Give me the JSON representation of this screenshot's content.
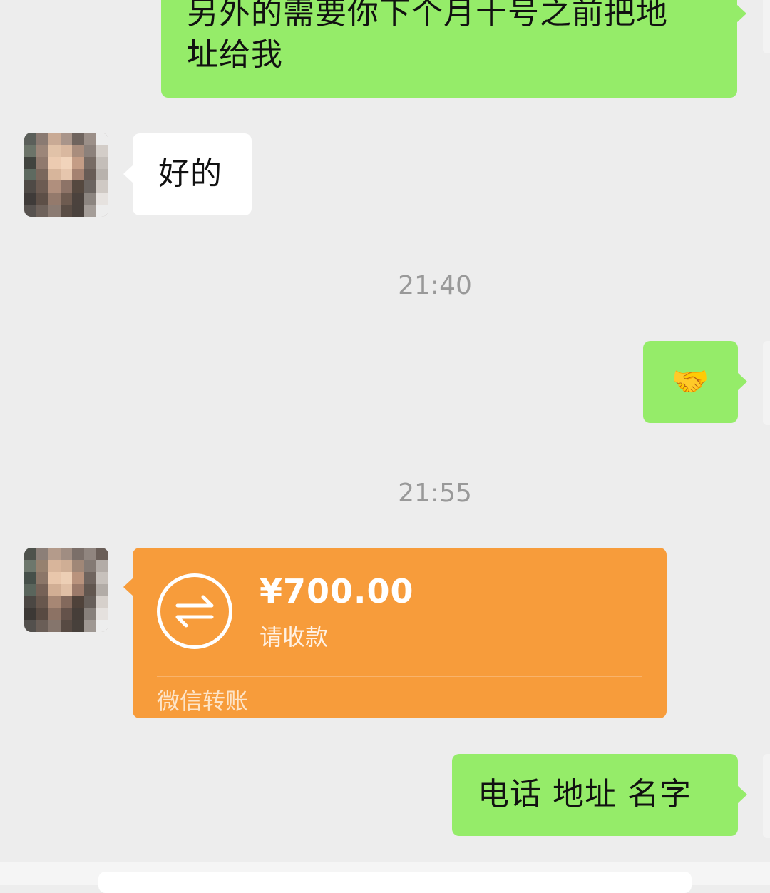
{
  "messages": {
    "m1_line1": "另外的需要你下个月十号之前把地",
    "m1_line2": "址给我",
    "m2": "好的",
    "time1": "21:40",
    "m3_emoji": "🤝",
    "time2": "21:55",
    "transfer": {
      "amount": "¥700.00",
      "status": "请收款",
      "source": "微信转账"
    },
    "m4": "电话 地址 名字"
  },
  "colors": {
    "chat_background": "#ededed",
    "self_bubble": "#95ec69",
    "other_bubble": "#ffffff",
    "transfer_card": "#f79c3b",
    "timestamp_text": "#999999"
  },
  "icons": {
    "transfer": "transfer-arrows-icon",
    "emoji": "handshake"
  }
}
